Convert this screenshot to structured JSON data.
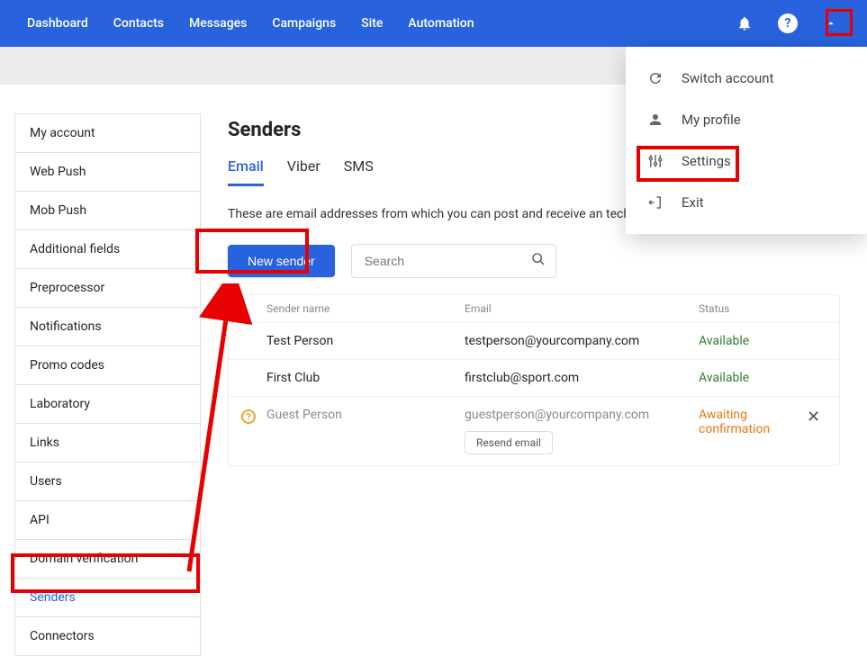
{
  "topnav": {
    "items": [
      "Dashboard",
      "Contacts",
      "Messages",
      "Campaigns",
      "Site",
      "Automation"
    ]
  },
  "dropdown": {
    "items": [
      {
        "icon": "refresh-icon",
        "label": "Switch account"
      },
      {
        "icon": "user-icon",
        "label": "My profile"
      },
      {
        "icon": "sliders-icon",
        "label": "Settings"
      },
      {
        "icon": "exit-icon",
        "label": "Exit"
      }
    ]
  },
  "sidebar": {
    "items": [
      "My account",
      "Web Push",
      "Mob Push",
      "Additional fields",
      "Preprocessor",
      "Notifications",
      "Promo codes",
      "Laboratory",
      "Links",
      "Users",
      "API",
      "Domain verification",
      "Senders",
      "Connectors"
    ],
    "active_index": 12
  },
  "page": {
    "title": "Senders",
    "tabs": [
      "Email",
      "Viber",
      "SMS"
    ],
    "active_tab": 0,
    "description": "These are email addresses from which you can post and receive an technical messages.",
    "new_sender_label": "New sender",
    "search_placeholder": "Search"
  },
  "table": {
    "headers": {
      "name": "Sender name",
      "email": "Email",
      "status": "Status"
    },
    "rows": [
      {
        "name": "Test Person",
        "email": "testperson@yourcompany.com",
        "status": "Available",
        "status_class": "status-available",
        "pending": false
      },
      {
        "name": "First Club",
        "email": "firstclub@sport.com",
        "status": "Available",
        "status_class": "status-available",
        "pending": false
      },
      {
        "name": "Guest Person",
        "email": "guestperson@yourcompany.com",
        "status": "Awaiting confirmation",
        "status_class": "status-pending",
        "pending": true
      }
    ],
    "resend_label": "Resend email"
  }
}
